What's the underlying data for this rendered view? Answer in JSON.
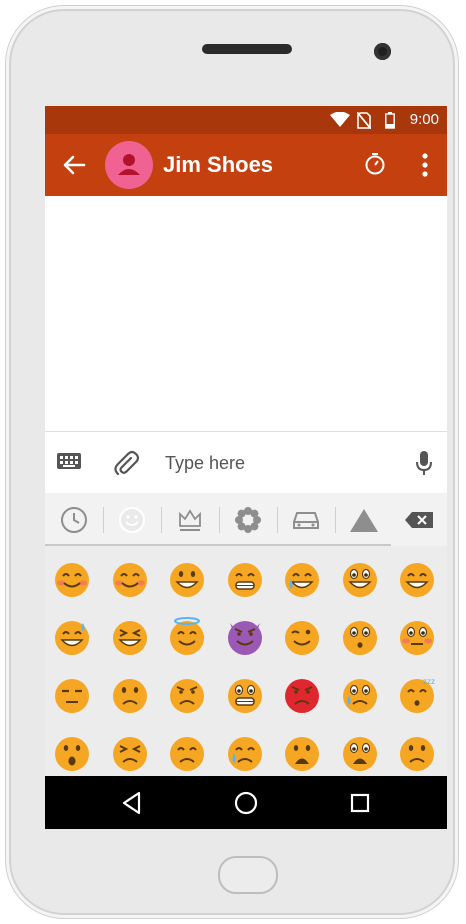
{
  "status_bar": {
    "time": "9:00",
    "icons": [
      "wifi-icon",
      "no-sim-icon",
      "battery-icon"
    ]
  },
  "app_bar": {
    "title": "Jim Shoes",
    "back_icon": "arrow-back-icon",
    "avatar_icon": "person-icon",
    "actions": [
      "timer-icon",
      "more-vert-icon"
    ]
  },
  "composer": {
    "placeholder": "Type here",
    "value": "",
    "left_icons": [
      "keyboard-icon",
      "attachment-icon"
    ],
    "right_icon": "mic-icon"
  },
  "emoji_tabs": [
    "recent-clock-icon",
    "smiley-icon",
    "crown-icon",
    "flower-icon",
    "car-icon",
    "triangle-icon",
    "backspace-icon"
  ],
  "active_tab": "smiley-icon",
  "emoji_rows": [
    [
      "blushing-smile",
      "happy-blush",
      "grinning",
      "grimacing-grin",
      "tears-of-joy",
      "grinning-big-eyes",
      "smiling-squint"
    ],
    [
      "sweat-smile",
      "laughing-squint",
      "halo-smile",
      "purple-devil",
      "winking",
      "hushed",
      "flushed"
    ],
    [
      "neutral",
      "confused",
      "angry",
      "grimacing",
      "pouting-red",
      "crying-sad",
      "sleeping"
    ],
    [
      "open-mouth",
      "confounded",
      "steam-nose",
      "sad-sweat",
      "frowning",
      "anguished",
      "worried"
    ]
  ],
  "colors": {
    "status_bar": "#a8380b",
    "app_bar": "#c5400f",
    "avatar": "#f06292",
    "emoji_face": "#f5a623",
    "devil": "#9b59b6",
    "pouting": "#e0262f"
  },
  "nav": [
    "back-triangle-icon",
    "home-circle-icon",
    "recents-square-icon"
  ]
}
